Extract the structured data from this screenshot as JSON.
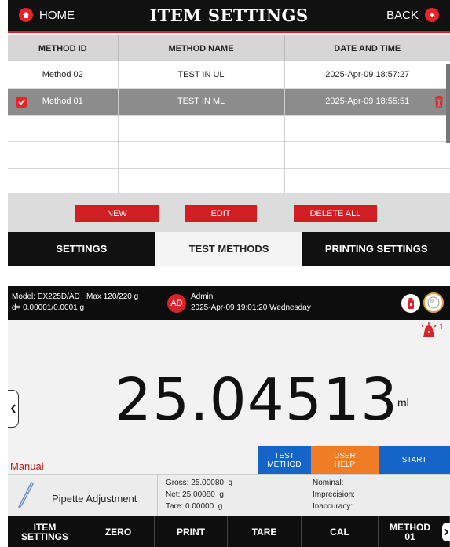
{
  "item_settings": {
    "home_label": "HOME",
    "title": "ITEM SETTINGS",
    "back_label": "BACK",
    "columns": [
      "METHOD ID",
      "METHOD NAME",
      "DATE AND TIME"
    ],
    "rows": [
      {
        "id": "Method 02",
        "name": "TEST IN UL",
        "datetime": "2025-Apr-09 18:57:27"
      },
      {
        "id": "Method 01",
        "name": "TEST IN ML",
        "datetime": "2025-Apr-09 18:55:51"
      }
    ],
    "buttons": {
      "new": "NEW",
      "edit": "EDIT",
      "delete_all": "DELETE ALL"
    },
    "tabs": [
      "SETTINGS",
      "TEST METHODS",
      "PRINTING SETTINGS"
    ],
    "accent_color": "#d01e25"
  },
  "balance": {
    "model_line": "Model: EX225D/AD   Max 120/220 g",
    "resolution_line": "d= 0.00001/0.0001 g",
    "badge": "AD",
    "user": "Admin",
    "datetime": "2025-Apr-09 19:01:20 Wednesday",
    "alarm_count": "1",
    "weight": "25.04513",
    "unit": "ml",
    "mode": "Manual",
    "mode_buttons": {
      "test_method": "TEST\nMETHOD",
      "user_help": "USER\nHELP",
      "start": "START"
    },
    "application": "Pipette Adjustment",
    "gross": "Gross: 25.00080  g",
    "net": "Net: 25.00080  g",
    "tare": "Tare: 0.00000  g",
    "nominal": "Nominal:",
    "imprecision": "Imprecision:",
    "inaccuracy": "Inaccuracy:",
    "function_keys": {
      "item_settings": "ITEM\nSETTINGS",
      "zero": "ZERO",
      "print": "PRINT",
      "tare": "TARE",
      "cal": "CAL",
      "method": "METHOD\n01"
    },
    "colors": {
      "blue": "#1565c8",
      "orange": "#f07d25",
      "red": "#d9232a"
    }
  }
}
